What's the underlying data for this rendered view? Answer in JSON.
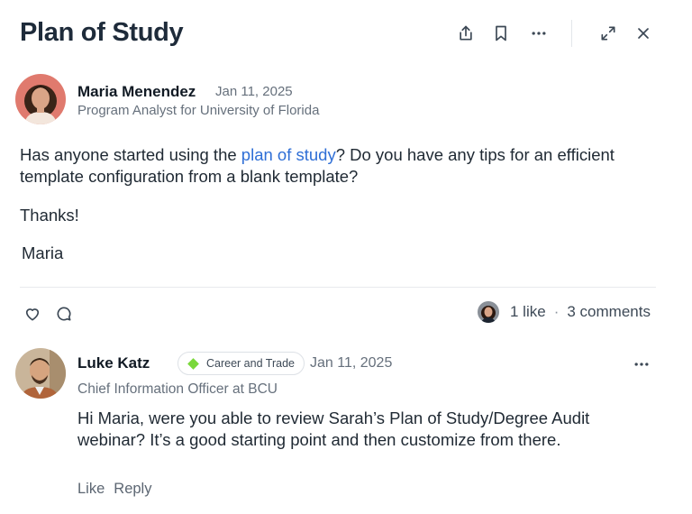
{
  "header": {
    "title": "Plan of Study",
    "icons": [
      "share-icon",
      "bookmark-icon",
      "more-icon",
      "expand-icon",
      "close-icon"
    ]
  },
  "post": {
    "author": {
      "name": "Maria Menendez",
      "date": "Jan 11, 2025",
      "role": "Program Analyst for University of Florida"
    },
    "body_before_link": "Has anyone started using the ",
    "link_text": "plan of study",
    "body_after_link": "? Do you have any tips for an efficient template configuration from a blank template?",
    "thanks": "Thanks!",
    "signature": "Maria",
    "stats": {
      "likes": "1 like",
      "separator": "·",
      "comments": "3 comments"
    }
  },
  "comment": {
    "author": {
      "name": "Luke Katz",
      "tag": "Career and Trade",
      "date": "Jan 11, 2025",
      "role": "Chief Information Officer at BCU"
    },
    "body": "Hi Maria, were you able to review Sarah’s Plan of Study/Degree Audit webinar? It’s a good starting point and then customize from there.",
    "actions": {
      "like": "Like",
      "reply": "Reply"
    }
  },
  "colors": {
    "link": "#2f6fd6",
    "tag_diamond": "#7ad83b",
    "title": "#1e2b3a"
  }
}
